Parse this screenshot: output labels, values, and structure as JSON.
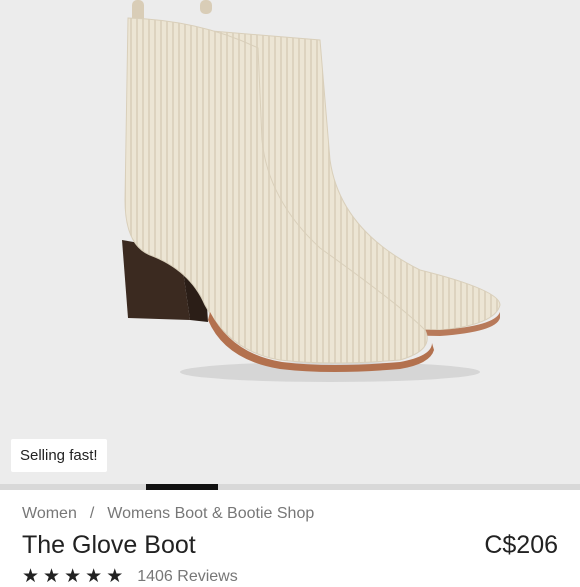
{
  "hero": {
    "badge": "Selling fast!",
    "image": "glove-boot-product-photo"
  },
  "carousel": {
    "active_index": 2,
    "count": 8
  },
  "breadcrumb": {
    "items": [
      "Women",
      "Womens Boot & Bootie Shop"
    ],
    "separator": "/"
  },
  "product": {
    "title": "The Glove Boot",
    "price": "C$206",
    "rating": 4.5,
    "reviews_label": "1406 Reviews"
  },
  "colors": {
    "image_bg": "#ececec",
    "knit": "#ece5d4",
    "heel": "#3b2a20",
    "text": "#222222",
    "muted": "#777777"
  }
}
